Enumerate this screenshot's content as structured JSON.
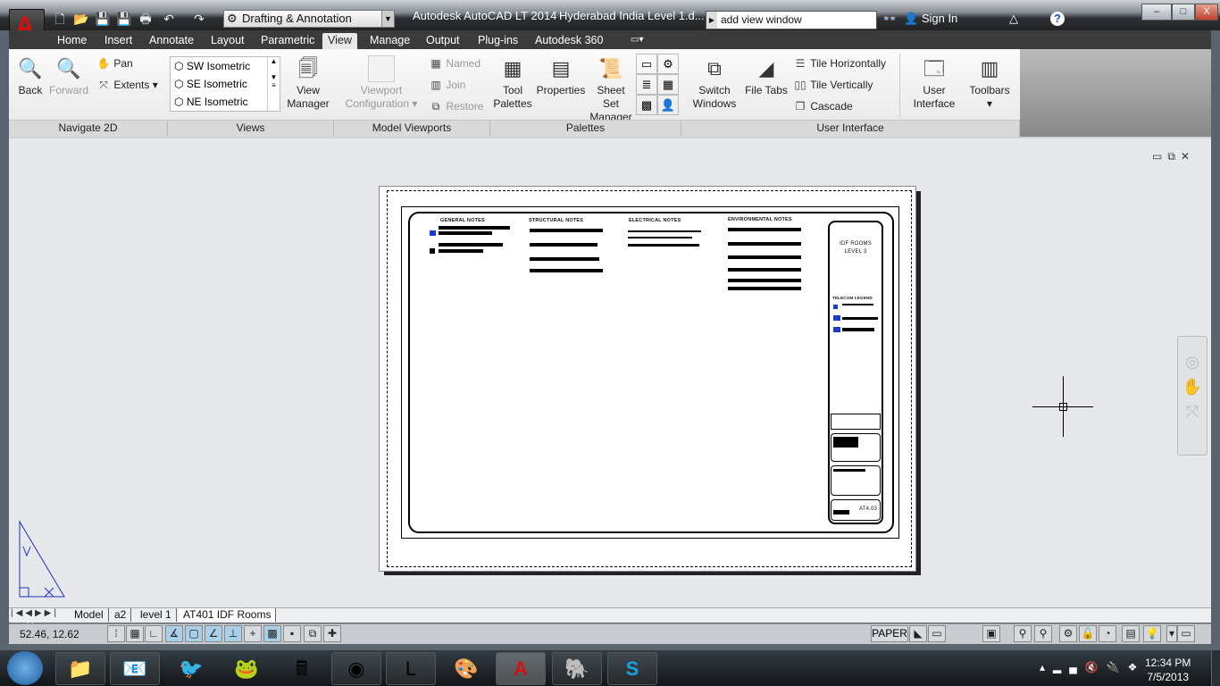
{
  "app": {
    "title": "Autodesk AutoCAD LT 2014",
    "document": "Hyderabad India Level 1.d...",
    "logo_text": "LT",
    "workspace": "Drafting & Annotation"
  },
  "search": {
    "value": "add view window",
    "sign_in": "Sign In"
  },
  "window_controls": {
    "minimize": "–",
    "maximize": "□",
    "close": "X"
  },
  "tabs": [
    "Home",
    "Insert",
    "Annotate",
    "Layout",
    "Parametric",
    "View",
    "Manage",
    "Output",
    "Plug-ins",
    "Autodesk 360"
  ],
  "active_tab": "View",
  "ribbon": {
    "navigate": {
      "label": "Navigate 2D",
      "back": "Back",
      "forward": "Forward",
      "pan": "Pan",
      "extents": "Extents"
    },
    "views": {
      "label": "Views",
      "items": [
        "SW Isometric",
        "SE Isometric",
        "NE Isometric"
      ],
      "manager1": "View",
      "manager2": "Manager"
    },
    "viewports": {
      "label": "Model Viewports",
      "config1": "Viewport",
      "config2": "Configuration",
      "named": "Named",
      "join": "Join",
      "restore": "Restore"
    },
    "palettes": {
      "label": "Palettes",
      "tool1": "Tool",
      "tool2": "Palettes",
      "properties": "Properties",
      "ssm1": "Sheet Set",
      "ssm2": "Manager"
    },
    "ui": {
      "label": "User Interface",
      "switch1": "Switch",
      "switch2": "Windows",
      "file_tabs": "File Tabs",
      "tile_h": "Tile Horizontally",
      "tile_v": "Tile Vertically",
      "cascade": "Cascade",
      "ui1": "User",
      "ui2": "Interface",
      "toolbars": "Toolbars"
    }
  },
  "sheet": {
    "notes": [
      "GENERAL NOTES",
      "STRUCTURAL NOTES",
      "ELECTRICAL NOTES",
      "ENVIRONMENTAL NOTES"
    ],
    "title1": "IDF ROOMS",
    "title2": "LEVEL 3",
    "legend": "TELECOM LEGEND",
    "sheet_no": "AT4.03"
  },
  "layout_tabs": [
    "Model",
    "a2",
    "level 1",
    "AT401 IDF Rooms"
  ],
  "active_layout": "AT401 IDF Rooms",
  "status": {
    "coords": "52.46, 12.62",
    "space": "PAPER"
  },
  "taskbar": {
    "apps": [
      "file-explorer",
      "outlook",
      "thunderbird",
      "frog-app",
      "calculator",
      "chrome",
      "lync",
      "paint",
      "autocad-lt",
      "evernote",
      "skype"
    ],
    "time": "12:34 PM",
    "date": "7/5/2013"
  }
}
